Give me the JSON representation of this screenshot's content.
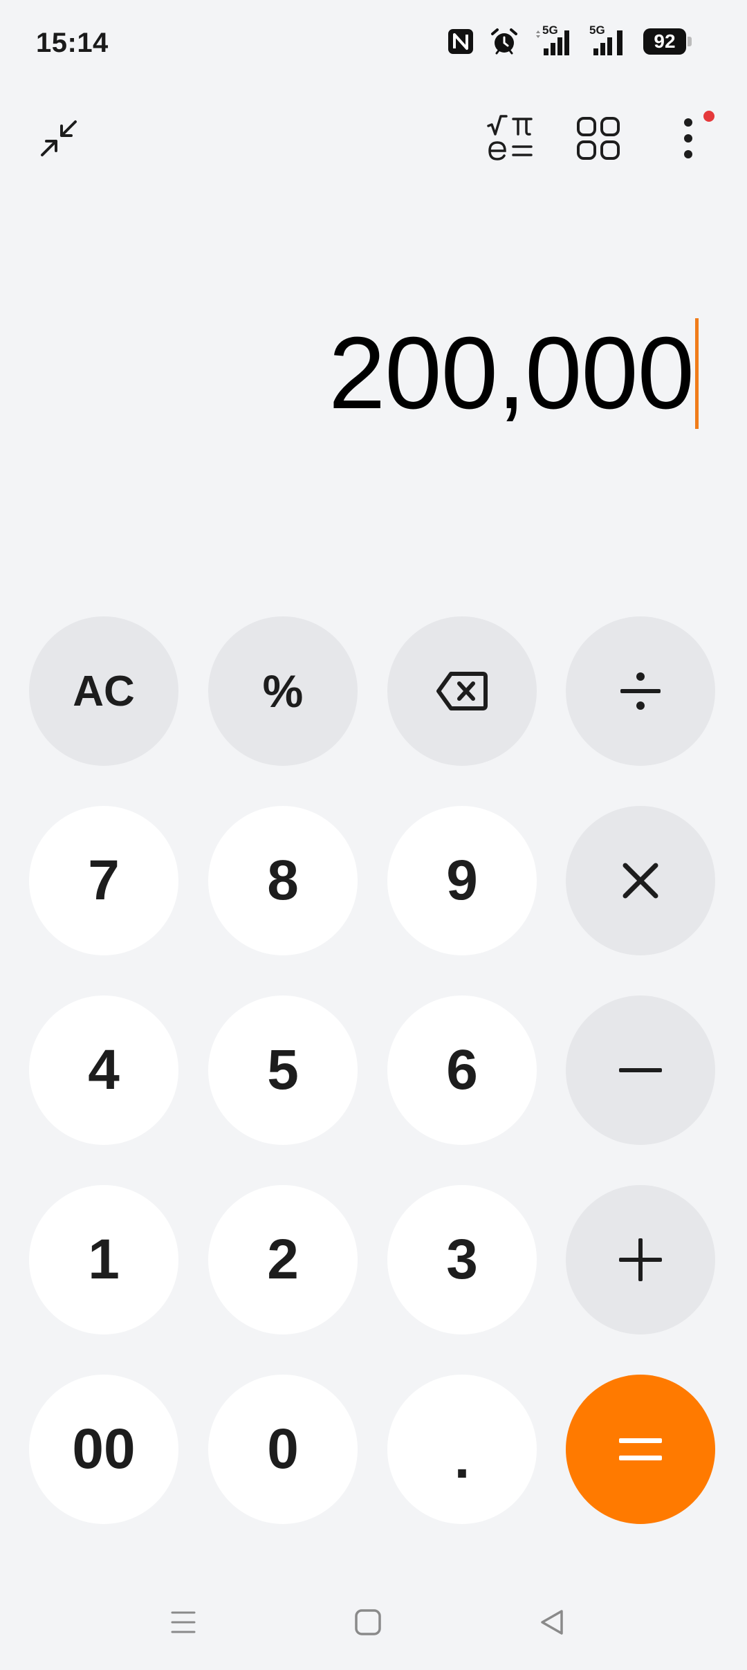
{
  "status_bar": {
    "time": "15:14",
    "network_1": "5G",
    "network_2": "5G",
    "battery_level": "92",
    "icons": [
      "nfc-icon",
      "alarm-icon",
      "signal-icon",
      "signal-icon",
      "battery-icon"
    ]
  },
  "toolbar": {
    "icons": [
      "collapse-icon",
      "scientific-icon",
      "grid-icon",
      "more-icon"
    ],
    "notification_dot_color": "#e5393b"
  },
  "display": {
    "value": "200,000"
  },
  "keypad": {
    "row1": [
      "AC",
      "%",
      "backspace-icon",
      "divide-icon"
    ],
    "row2": [
      "7",
      "8",
      "9",
      "multiply-icon"
    ],
    "row3": [
      "4",
      "5",
      "6",
      "minus-icon"
    ],
    "row4": [
      "1",
      "2",
      "3",
      "plus-icon"
    ],
    "row5": [
      "00",
      "0",
      ".",
      "equals-icon"
    ],
    "labels": {
      "ac": "AC",
      "percent": "%",
      "seven": "7",
      "eight": "8",
      "nine": "9",
      "four": "4",
      "five": "5",
      "six": "6",
      "one": "1",
      "two": "2",
      "three": "3",
      "double_zero": "00",
      "zero": "0",
      "dot": "."
    }
  },
  "colors": {
    "accent": "#ff7a00",
    "caret": "#f07c1a",
    "background": "#f3f4f6",
    "number_key": "#ffffff",
    "operator_key": "#e6e7ea"
  },
  "navbar": {
    "icons": [
      "menu-icon",
      "home-icon",
      "back-icon"
    ]
  }
}
